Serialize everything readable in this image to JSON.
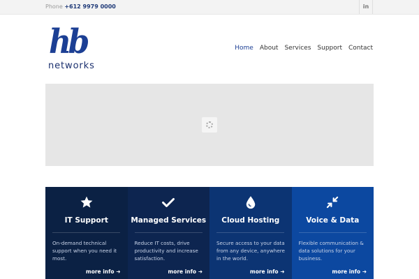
{
  "topbar": {
    "phone_label": "Phone",
    "phone_number": "+612 9979 0000",
    "social_icon": "linkedin-icon",
    "social_text": "in"
  },
  "logo": {
    "mark": "hb",
    "sub": "networks",
    "color": "#1c3f94"
  },
  "nav": {
    "items": [
      "Home",
      "About",
      "Services",
      "Support",
      "Contact"
    ],
    "active": "Home"
  },
  "banner": {
    "loader_icon": "loading-spinner-icon"
  },
  "services": [
    {
      "icon": "star-icon",
      "title": "IT Support",
      "description": "On-demand technical support when you need it most.",
      "link": "more info",
      "arrow_icon": "arrow-right-icon",
      "color": "#0b2144"
    },
    {
      "icon": "checkmark-icon",
      "title": "Managed Services",
      "description": "Reduce IT costs, drive productivity and increase satisfaction.",
      "link": "more info",
      "arrow_icon": "arrow-right-icon",
      "color": "#0d2550"
    },
    {
      "icon": "droplet-icon",
      "title": "Cloud Hosting",
      "description": "Secure access to your data from any device, anywhere in the world.",
      "link": "more info",
      "arrow_icon": "arrow-right-icon",
      "color": "#0c3473"
    },
    {
      "icon": "compress-arrows-icon",
      "title": "Voice & Data",
      "description": "Flexible communication & data solutions for your business.",
      "link": "more info",
      "arrow_icon": "arrow-right-icon",
      "color": "#0c48a0"
    }
  ]
}
